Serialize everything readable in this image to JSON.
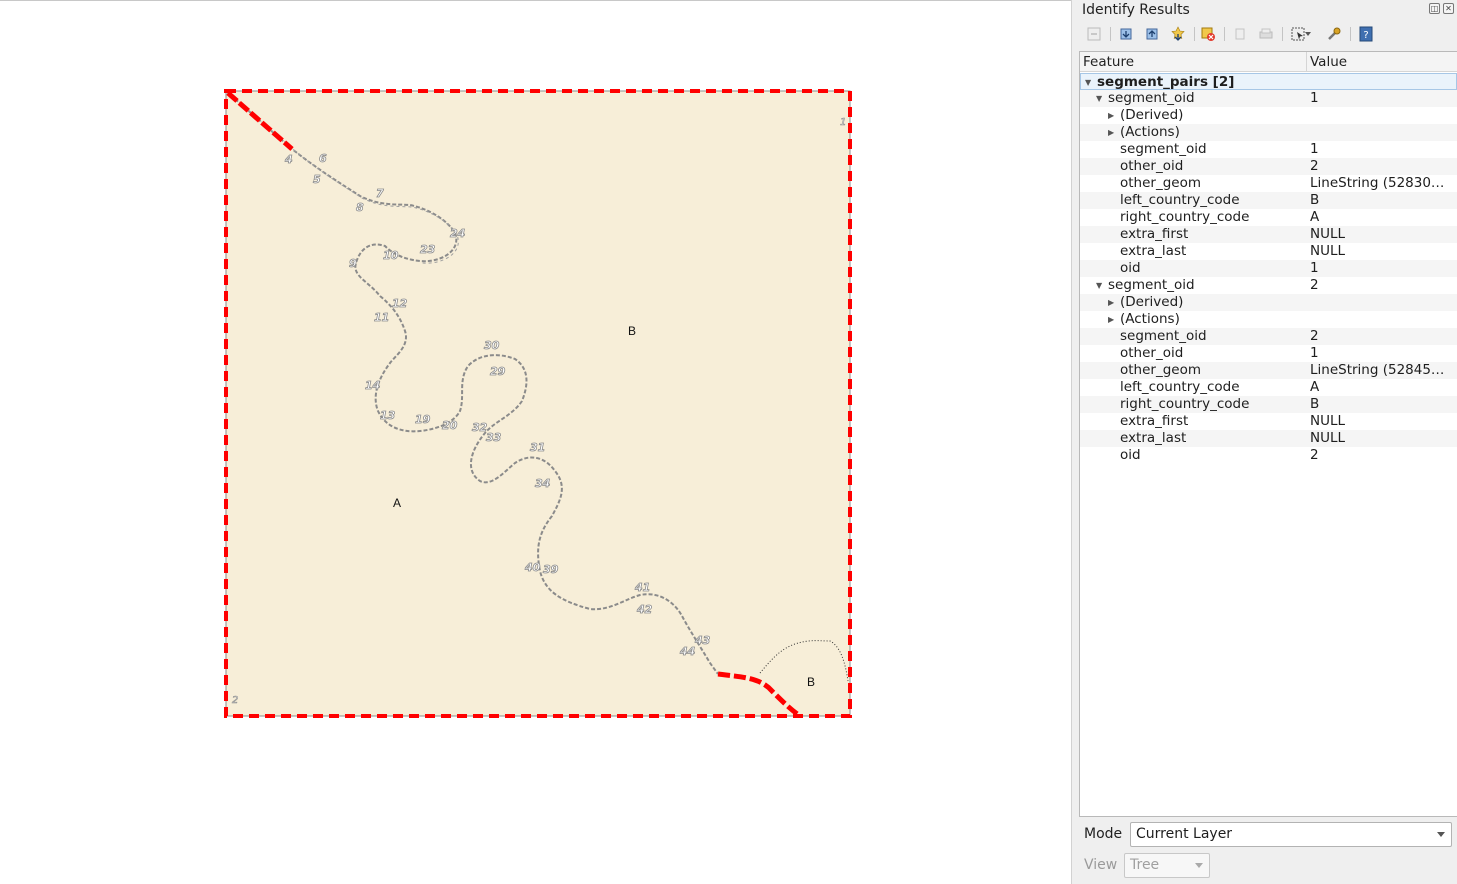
{
  "map": {
    "polygon_labels": [
      "B",
      "A",
      "B"
    ],
    "corner_labels": [
      "1",
      "2"
    ],
    "vertex_labels_gray": [
      "1",
      "4",
      "5",
      "6",
      "7",
      "8",
      "9",
      "10",
      "11",
      "12",
      "13",
      "14",
      "19",
      "20",
      "23",
      "24",
      "29",
      "30",
      "31",
      "32",
      "33",
      "34",
      "39",
      "40",
      "41",
      "42",
      "43",
      "44"
    ],
    "vertex_labels": [
      "4",
      "5",
      "6",
      "7",
      "8",
      "9",
      "10",
      "11",
      "12",
      "13",
      "14",
      "19",
      "20",
      "23",
      "24",
      "29",
      "30",
      "31",
      "32",
      "33",
      "34",
      "39",
      "40",
      "41",
      "42",
      "43",
      "44"
    ],
    "colors": {
      "polygon_fill": "#f7eed8",
      "highlight": "#ff0000",
      "line": "#8b8b8b"
    }
  },
  "panel": {
    "title": "Identify Results",
    "toolbar_icons": [
      "expand-all-icon",
      "expand-icon",
      "collapse-icon",
      "expand-new-icon",
      "clear-icon",
      "copy-icon",
      "print-icon",
      "select-tool-icon",
      "settings-icon",
      "help-icon"
    ],
    "columns": {
      "feature": "Feature",
      "value": "Value"
    },
    "rows": [
      {
        "feature": "segment_pairs  [2]",
        "value": "",
        "depth": 0,
        "arrow": "open",
        "kind": "layer"
      },
      {
        "feature": "segment_oid",
        "value": "1",
        "depth": 1,
        "arrow": "open"
      },
      {
        "feature": "(Derived)",
        "value": "",
        "depth": 2,
        "arrow": "closed"
      },
      {
        "feature": "(Actions)",
        "value": "",
        "depth": 2,
        "arrow": "closed"
      },
      {
        "feature": "segment_oid",
        "value": "1",
        "depth": 2,
        "arrow": ""
      },
      {
        "feature": "other_oid",
        "value": "2",
        "depth": 2,
        "arrow": ""
      },
      {
        "feature": "other_geom",
        "value": "LineString (52830…",
        "depth": 2,
        "arrow": ""
      },
      {
        "feature": "left_country_code",
        "value": "B",
        "depth": 2,
        "arrow": ""
      },
      {
        "feature": "right_country_code",
        "value": "A",
        "depth": 2,
        "arrow": ""
      },
      {
        "feature": "extra_first",
        "value": "NULL",
        "depth": 2,
        "arrow": ""
      },
      {
        "feature": "extra_last",
        "value": "NULL",
        "depth": 2,
        "arrow": ""
      },
      {
        "feature": "oid",
        "value": "1",
        "depth": 2,
        "arrow": ""
      },
      {
        "feature": "segment_oid",
        "value": "2",
        "depth": 1,
        "arrow": "open"
      },
      {
        "feature": "(Derived)",
        "value": "",
        "depth": 2,
        "arrow": "closed"
      },
      {
        "feature": "(Actions)",
        "value": "",
        "depth": 2,
        "arrow": "closed"
      },
      {
        "feature": "segment_oid",
        "value": "2",
        "depth": 2,
        "arrow": ""
      },
      {
        "feature": "other_oid",
        "value": "1",
        "depth": 2,
        "arrow": ""
      },
      {
        "feature": "other_geom",
        "value": "LineString (52845…",
        "depth": 2,
        "arrow": ""
      },
      {
        "feature": "left_country_code",
        "value": "A",
        "depth": 2,
        "arrow": ""
      },
      {
        "feature": "right_country_code",
        "value": "B",
        "depth": 2,
        "arrow": ""
      },
      {
        "feature": "extra_first",
        "value": "NULL",
        "depth": 2,
        "arrow": ""
      },
      {
        "feature": "extra_last",
        "value": "NULL",
        "depth": 2,
        "arrow": ""
      },
      {
        "feature": "oid",
        "value": "2",
        "depth": 2,
        "arrow": ""
      }
    ],
    "mode": {
      "label": "Mode",
      "value": "Current Layer"
    },
    "view": {
      "label": "View",
      "value": "Tree"
    }
  }
}
